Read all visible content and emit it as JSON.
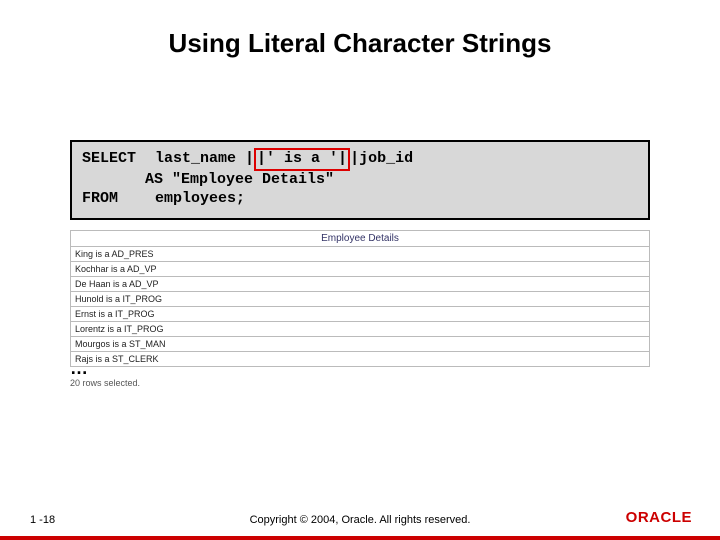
{
  "title": "Using Literal Character Strings",
  "code": {
    "kw1": "SELECT",
    "line1a": "last_name |",
    "highlight": "|' is a '|",
    "line1b": "|job_id",
    "line2": "       AS \"Employee Details\"",
    "kw2": "FROM",
    "line3": "employees;"
  },
  "results": {
    "header": "Employee Details",
    "rows": [
      "King is a AD_PRES",
      "Kochhar is a AD_VP",
      "De Haan is a AD_VP",
      "Hunold is a IT_PROG",
      "Ernst is a IT_PROG",
      "Lorentz is a IT_PROG",
      "Mourgos is a ST_MAN",
      "Rajs is a ST_CLERK"
    ]
  },
  "ellipsis": "…",
  "rowcount": "20 rows selected.",
  "footer": {
    "slide_num": "1 -18",
    "copyright": "Copyright © 2004, Oracle.  All rights reserved.",
    "logo": "ORACLE"
  }
}
